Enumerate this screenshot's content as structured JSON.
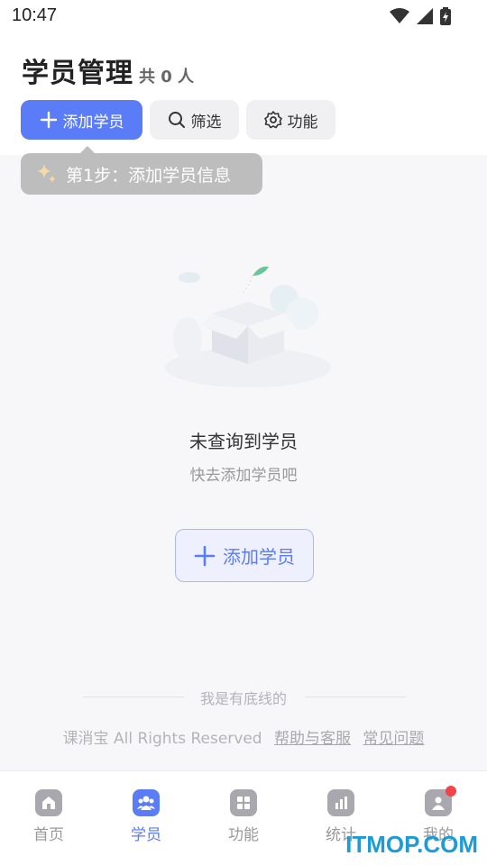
{
  "status_bar": {
    "time": "10:47"
  },
  "header": {
    "title": "学员管理",
    "count": "共 0 人",
    "buttons": {
      "add": "添加学员",
      "filter": "筛选",
      "function": "功能"
    }
  },
  "tooltip": {
    "text": "第1步：添加学员信息"
  },
  "empty_state": {
    "title": "未查询到学员",
    "subtitle": "快去添加学员吧",
    "add_button": "添加学员"
  },
  "footer": {
    "divider_text": "我是有底线的",
    "copyright": "课消宝 All Rights Reserved",
    "links": [
      "帮助与客服",
      "常见问题"
    ]
  },
  "tabbar": {
    "items": [
      {
        "label": "首页",
        "icon": "home-icon"
      },
      {
        "label": "学员",
        "icon": "students-icon"
      },
      {
        "label": "功能",
        "icon": "grid-icon"
      },
      {
        "label": "统计",
        "icon": "chart-icon"
      },
      {
        "label": "我的",
        "icon": "user-icon"
      }
    ],
    "active_index": 1
  },
  "watermark": "ITMOP.COM",
  "colors": {
    "accent": "#5b7cf7",
    "badge": "#f2434a",
    "tooltip": "#bdbdbd"
  }
}
